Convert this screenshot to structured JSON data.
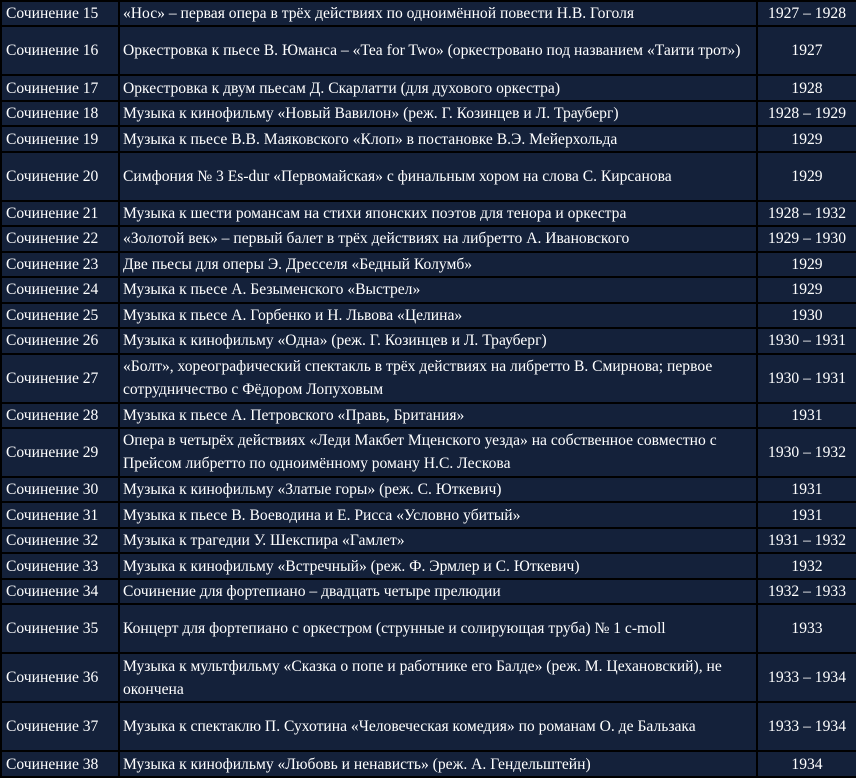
{
  "rows": [
    {
      "num": "Сочинение 15",
      "title": "«Нос» – первая опера в трёх действиях по одноимённой повести Н.В. Гоголя",
      "year": "1927 – 1928"
    },
    {
      "num": "Сочинение 16",
      "title": "Оркестровка к пьесе В. Юманса – «Tea for Two» (оркестровано под названием «Таити трот»)",
      "year": "1927"
    },
    {
      "num": "Сочинение 17",
      "title": "Оркестровка к двум пьесам Д. Скарлатти (для духового оркестра)",
      "year": "1928"
    },
    {
      "num": "Сочинение 18",
      "title": "Музыка к кинофильму «Новый Вавилон» (реж. Г. Козинцев и Л. Трауберг)",
      "year": "1928 – 1929"
    },
    {
      "num": "Сочинение 19",
      "title": "Музыка к пьесе В.В. Маяковского «Клоп» в постановке В.Э. Мейерхольда",
      "year": "1929"
    },
    {
      "num": "Сочинение 20",
      "title": "Симфония № 3 Es-dur «Первомайская» с финальным хором на слова С. Кирсанова",
      "year": "1929"
    },
    {
      "num": "Сочинение 21",
      "title": "Музыка к шести романсам на стихи японских поэтов для тенора и оркестра",
      "year": "1928 – 1932"
    },
    {
      "num": "Сочинение 22",
      "title": "«Золотой век» – первый  балет в трёх действиях на либретто А. Ивановского",
      "year": "1929 – 1930"
    },
    {
      "num": "Сочинение 23",
      "title": "Две пьесы для оперы Э. Дресселя «Бедный Колумб»",
      "year": "1929"
    },
    {
      "num": "Сочинение 24",
      "title": "Музыка к пьесе А. Безыменского «Выстрел»",
      "year": "1929"
    },
    {
      "num": "Сочинение 25",
      "title": "Музыка к пьесе А. Горбенко и Н. Львова «Целина»",
      "year": "1930"
    },
    {
      "num": "Сочинение 26",
      "title": "Музыка к кинофильму «Одна» (реж. Г. Козинцев и Л. Трауберг)",
      "year": "1930 – 1931"
    },
    {
      "num": "Сочинение 27",
      "title": "«Болт», хореографический спектакль в трёх действиях на либретто В. Смирнова; первое сотрудничество с Фёдором Лопуховым",
      "year": "1930 – 1931"
    },
    {
      "num": "Сочинение 28",
      "title": "Музыка к пьесе А. Петровского «Правь, Британия»",
      "year": "1931"
    },
    {
      "num": "Сочинение 29",
      "title": "Опера в четырёх действиях «Леди Макбет Мценского уезда» на собственное совместно с Прейсом либретто по одноимённому роману Н.С. Лескова",
      "year": "1930 – 1932"
    },
    {
      "num": "Сочинение 30",
      "title": "Музыка к кинофильму «Златые горы» (реж. С. Юткевич)",
      "year": "1931"
    },
    {
      "num": "Сочинение 31",
      "title": "Музыка к пьесе В. Воеводина и Е. Рисса «Условно убитый»",
      "year": "1931"
    },
    {
      "num": "Сочинение 32",
      "title": "Музыка к трагедии У. Шекспира «Гамлет»",
      "year": "1931 – 1932"
    },
    {
      "num": "Сочинение 33",
      "title": "Музыка к кинофильму «Встречный» (реж. Ф. Эрмлер и С. Юткевич)",
      "year": "1932"
    },
    {
      "num": "Сочинение 34",
      "title": "Сочинение для фортепиано – двадцать четыре прелюдии",
      "year": "1932 – 1933"
    },
    {
      "num": "Сочинение 35",
      "title": "Концерт для фортепиано с оркестром (струнные и солирующая труба) № 1 c-moll",
      "year": "1933"
    },
    {
      "num": "Сочинение 36",
      "title": "Музыка к мультфильму «Сказка о попе и работнике его Балде» (реж. М. Цехановский), не окончена",
      "year": "1933 – 1934"
    },
    {
      "num": "Сочинение 37",
      "title": "Музыка к спектаклю П. Сухотина «Человеческая комедия» по романам О. де Бальзака",
      "year": "1933 – 1934"
    },
    {
      "num": "Сочинение 38",
      "title": "Музыка к кинофильму «Любовь и ненависть» (реж. А. Гендельштейн)",
      "year": "1934"
    }
  ]
}
